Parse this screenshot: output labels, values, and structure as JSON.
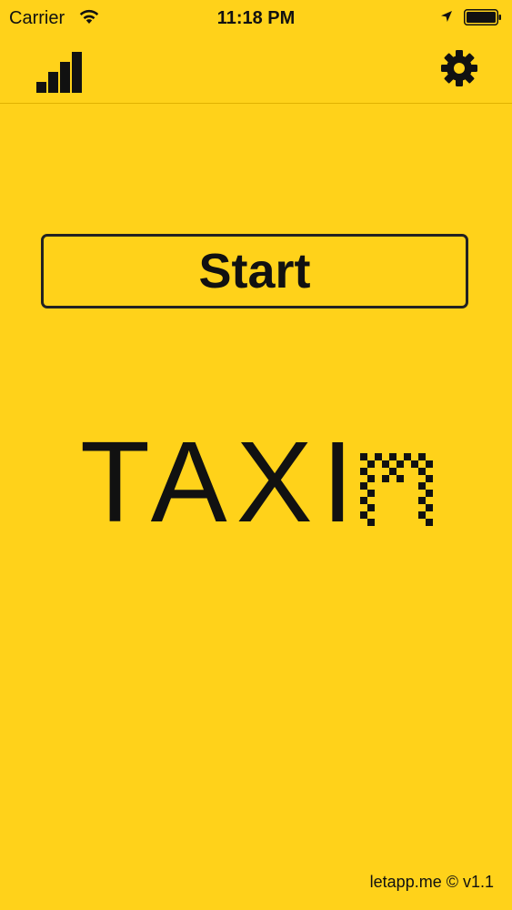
{
  "status_bar": {
    "carrier": "Carrier",
    "time": "11:18 PM",
    "wifi_icon": "wifi-icon",
    "location_icon": "location-arrow-icon",
    "battery_icon": "battery-icon"
  },
  "nav": {
    "left_icon": "bar-chart-icon",
    "right_icon": "gear-icon"
  },
  "main": {
    "start_label": "Start"
  },
  "logo": {
    "text": "TAXI"
  },
  "footer": {
    "text": "letapp.me © v1.1"
  },
  "colors": {
    "background": "#FFD21A",
    "foreground": "#111111"
  }
}
